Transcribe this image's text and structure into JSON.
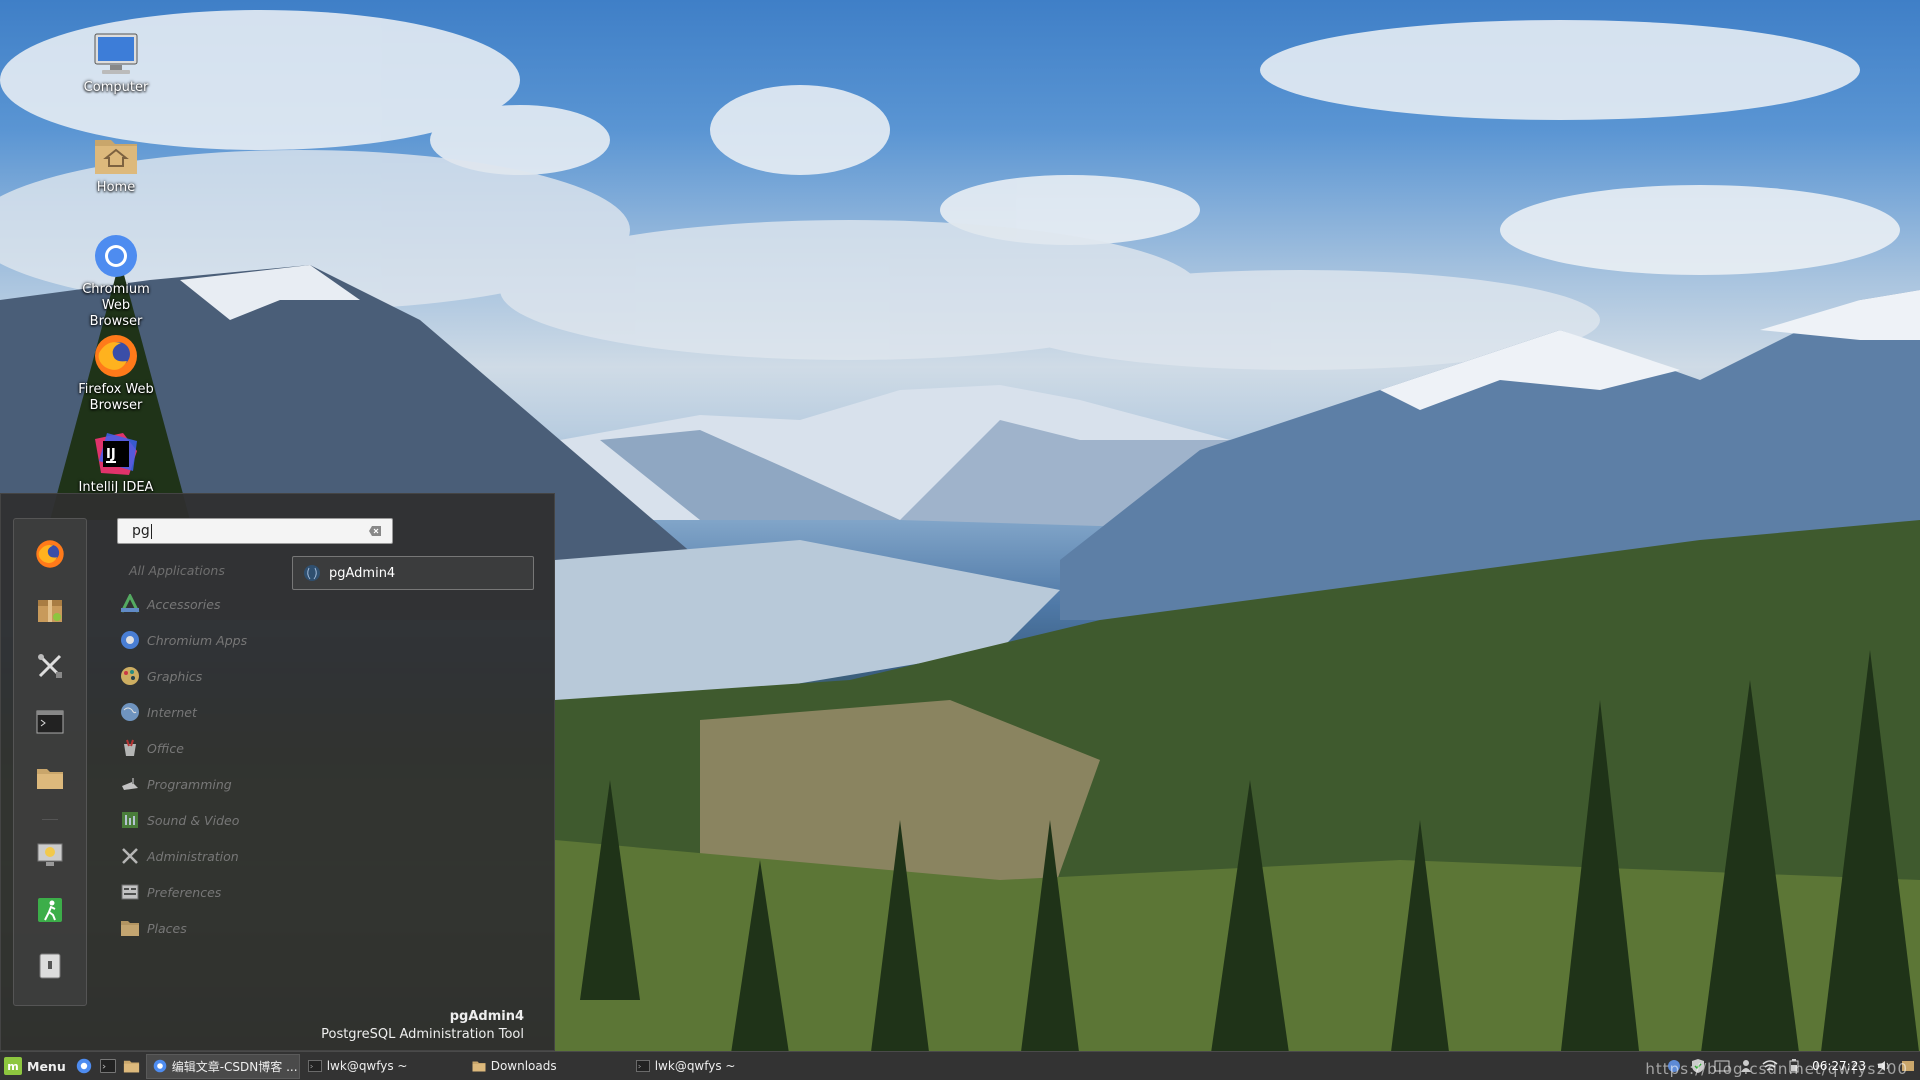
{
  "desktop": {
    "icons": [
      {
        "label": "Computer",
        "icon": "computer-icon"
      },
      {
        "label": "Home",
        "icon": "home-folder-icon"
      },
      {
        "label": "Chromium Web Browser",
        "icon": "chromium-icon"
      },
      {
        "label": "Firefox Web Browser",
        "icon": "firefox-icon"
      },
      {
        "label": "IntelliJ IDEA",
        "icon": "intellij-icon"
      }
    ]
  },
  "menu": {
    "search": {
      "value": "pg"
    },
    "favorites": [
      "firefox-icon",
      "package-manager-icon",
      "system-settings-icon",
      "terminal-icon",
      "files-icon",
      "lock-screen-icon",
      "logout-icon",
      "shutdown-icon"
    ],
    "categories": [
      {
        "label": "All Applications",
        "icon": ""
      },
      {
        "label": "Accessories",
        "icon": "accessories-icon"
      },
      {
        "label": "Chromium Apps",
        "icon": "chromium-icon"
      },
      {
        "label": "Graphics",
        "icon": "graphics-icon"
      },
      {
        "label": "Internet",
        "icon": "internet-icon"
      },
      {
        "label": "Office",
        "icon": "office-icon"
      },
      {
        "label": "Programming",
        "icon": "programming-icon"
      },
      {
        "label": "Sound & Video",
        "icon": "sound-video-icon"
      },
      {
        "label": "Administration",
        "icon": "administration-icon"
      },
      {
        "label": "Preferences",
        "icon": "preferences-icon"
      },
      {
        "label": "Places",
        "icon": "places-folder-icon"
      }
    ],
    "results": [
      {
        "label": "pgAdmin4",
        "icon": "pgadmin-icon"
      }
    ],
    "description": {
      "title": "pgAdmin4",
      "subtitle": "PostgreSQL Administration Tool"
    }
  },
  "taskbar": {
    "menu_label": "Menu",
    "windows": [
      {
        "label": "编辑文章-CSDN博客 ...",
        "icon": "chromium-icon"
      },
      {
        "label": "lwk@qwfys ~",
        "icon": "terminal-icon"
      },
      {
        "label": "Downloads",
        "icon": "folder-icon"
      },
      {
        "label": "lwk@qwfys ~",
        "icon": "terminal-icon"
      }
    ],
    "clock": "06:27:23"
  },
  "watermark": "https://blog.csdn.net/qwfys200"
}
